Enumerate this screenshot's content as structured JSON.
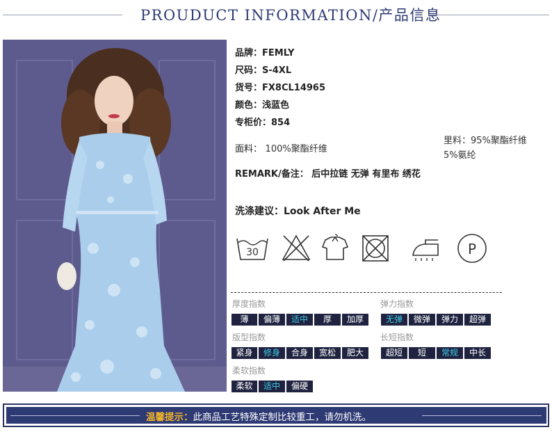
{
  "header": {
    "title": "PROUDUCT INFORMATION/产品信息"
  },
  "specs": {
    "brand": "品牌：FEMLY",
    "size": "尺码：S-4XL",
    "item_no": "货号：FX8CL14965",
    "color": "颜色：浅蓝色",
    "price": "专柜价：854",
    "fabric_label": "面料：",
    "fabric_value": "100%聚酯纤维",
    "lining_label": "里料：",
    "lining_value1": "95%聚酯纤维",
    "lining_value2": "5%氨纶",
    "remark_label": "REMARK/备注：",
    "remark_value": "后中拉链 无弹 有里布 绣花",
    "wash_label": "洗涤建议：",
    "wash_value": "Look After Me"
  },
  "care_icons": [
    "wash-30-icon",
    "no-bleach-icon",
    "hang-dry-icon",
    "no-tumble-dry-icon",
    "iron-icon",
    "dry-clean-p-icon"
  ],
  "care_wash_temp": "30",
  "care_dryclean_letter": "P",
  "indices": {
    "thickness": {
      "title": "厚度指数",
      "options": [
        "薄",
        "偏薄",
        "适中",
        "厚",
        "加厚"
      ],
      "selected": "适中"
    },
    "elasticity": {
      "title": "弹力指数",
      "options": [
        "无弹",
        "微弹",
        "弹力",
        "超弹"
      ],
      "selected": "无弹"
    },
    "fit": {
      "title": "版型指数",
      "options": [
        "紧身",
        "修身",
        "合身",
        "宽松",
        "肥大"
      ],
      "selected": "修身"
    },
    "length": {
      "title": "长短指数",
      "options": [
        "超短",
        "短",
        "常规",
        "中长"
      ],
      "selected": "常规"
    },
    "softness": {
      "title": "柔软指数",
      "options": [
        "柔软",
        "适中",
        "偏硬"
      ],
      "selected": "适中"
    }
  },
  "footer": {
    "label": "温馨提示：",
    "text": "此商品工艺特殊定制比较重工，请勿机洗。"
  },
  "colors": {
    "navy": "#2e3a74",
    "box_bg": "#1f2340",
    "box_selected_text": "#3ecbe8",
    "footer_label": "#f3b52a",
    "dress": "#a9cdea"
  }
}
